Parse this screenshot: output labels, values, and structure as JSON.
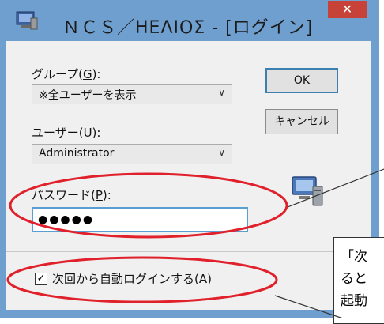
{
  "window": {
    "title": "ＮＣＳ／ΗΕΛΙΟΣ - [ログイン]",
    "close_label": "✕"
  },
  "group": {
    "label_prefix": "グループ(",
    "label_key": "G",
    "label_suffix": "):",
    "selected": "※全ユーザーを表示"
  },
  "user": {
    "label_prefix": "ユーザー(",
    "label_key": "U",
    "label_suffix": "):",
    "selected": "Administrator"
  },
  "password": {
    "label_prefix": "パスワード(",
    "label_key": "P",
    "label_suffix": "):",
    "value": "●●●●●"
  },
  "buttons": {
    "ok": "OK",
    "cancel": "キャンセル"
  },
  "auto_login": {
    "checked": true,
    "check_mark": "✓",
    "label_prefix": "次回から自動ログインする(",
    "label_key": "A",
    "label_suffix": ")"
  },
  "callout": {
    "line1": "「次",
    "line2": "ると",
    "line3": "起動"
  },
  "colors": {
    "titlebar": "#6f9fce",
    "close": "#c74238",
    "annotation": "#e0202a"
  },
  "icons": {
    "app": "app-icon",
    "computer": "computer-icon",
    "dropdown": "chevron-down-icon"
  }
}
